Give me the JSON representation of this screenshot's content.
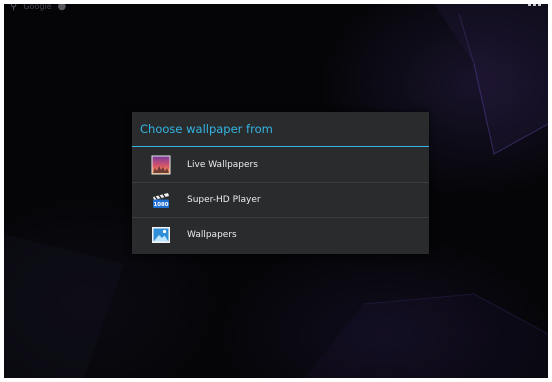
{
  "home_screen": {
    "search_label": "Google",
    "search_icon": "search-icon",
    "voice_icon": "microphone-icon",
    "apps_icon": "apps-grid-icon"
  },
  "dialog": {
    "title": "Choose wallpaper from",
    "accent_color": "#33b5e5",
    "background_color": "#2a2b2d",
    "options": [
      {
        "label": "Live Wallpapers",
        "icon": "live-wallpapers-icon"
      },
      {
        "label": "Super-HD Player",
        "icon": "super-hd-player-icon"
      },
      {
        "label": "Wallpapers",
        "icon": "wallpapers-icon"
      }
    ]
  }
}
